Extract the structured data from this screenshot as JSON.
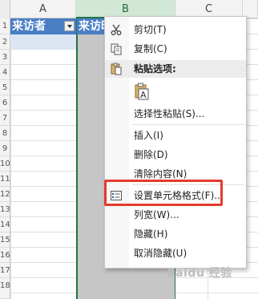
{
  "columns": [
    "A",
    "B",
    "C"
  ],
  "rows": [
    "1",
    "2",
    "3",
    "4",
    "5",
    "6",
    "7",
    "8",
    "9",
    "10",
    "11",
    "12",
    "13",
    "14",
    "15",
    "16",
    "17",
    "18"
  ],
  "header_cells": {
    "a": "来访者",
    "b": "来访时"
  },
  "context_menu": {
    "cut": "剪切(T)",
    "copy": "复制(C)",
    "paste_options": "粘贴选项:",
    "paste_special": "选择性粘贴(S)...",
    "insert": "插入(I)",
    "delete": "删除(D)",
    "clear": "清除内容(N)",
    "format_cells": "设置单元格格式(F)...",
    "column_width": "列宽(W)...",
    "hide": "隐藏(H)",
    "unhide": "取消隐藏(U)"
  },
  "watermark": "Baidu 经验",
  "colors": {
    "accent": "#217346",
    "header_fill": "#4a7ec5",
    "highlight": "#e43a2e"
  }
}
